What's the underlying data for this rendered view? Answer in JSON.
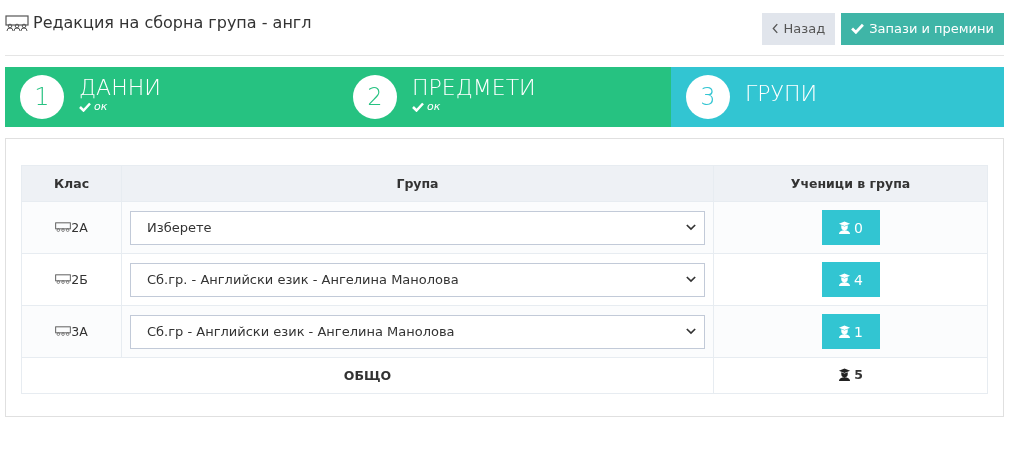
{
  "header": {
    "title": "Редакция на сборна група - англ",
    "buttons": [
      {
        "kind": "back",
        "label": "Назад"
      },
      {
        "kind": "save",
        "label": "Запази и премини"
      }
    ]
  },
  "steps": [
    {
      "number": "1",
      "label": "ДАННИ",
      "selected": false,
      "note": "ок"
    },
    {
      "number": "2",
      "label": "ПРЕДМЕТИ",
      "selected": false,
      "note": "ок"
    },
    {
      "number": "3",
      "label": "ГРУПИ",
      "selected": true
    }
  ],
  "table": {
    "columns": [
      "Клас",
      "Група",
      "Ученици в група"
    ],
    "rows": [
      {
        "class": "2А",
        "group": "Изберете",
        "students": "0"
      },
      {
        "class": "2Б",
        "group": "Сб.гр. - Английски език - Ангелина Манолова",
        "students": "4"
      },
      {
        "class": "3А",
        "group": "Сб.гр - Английски език - Ангелина Манолова",
        "students": "1"
      }
    ],
    "total": {
      "label": "ОБЩО",
      "students": "5"
    }
  }
}
